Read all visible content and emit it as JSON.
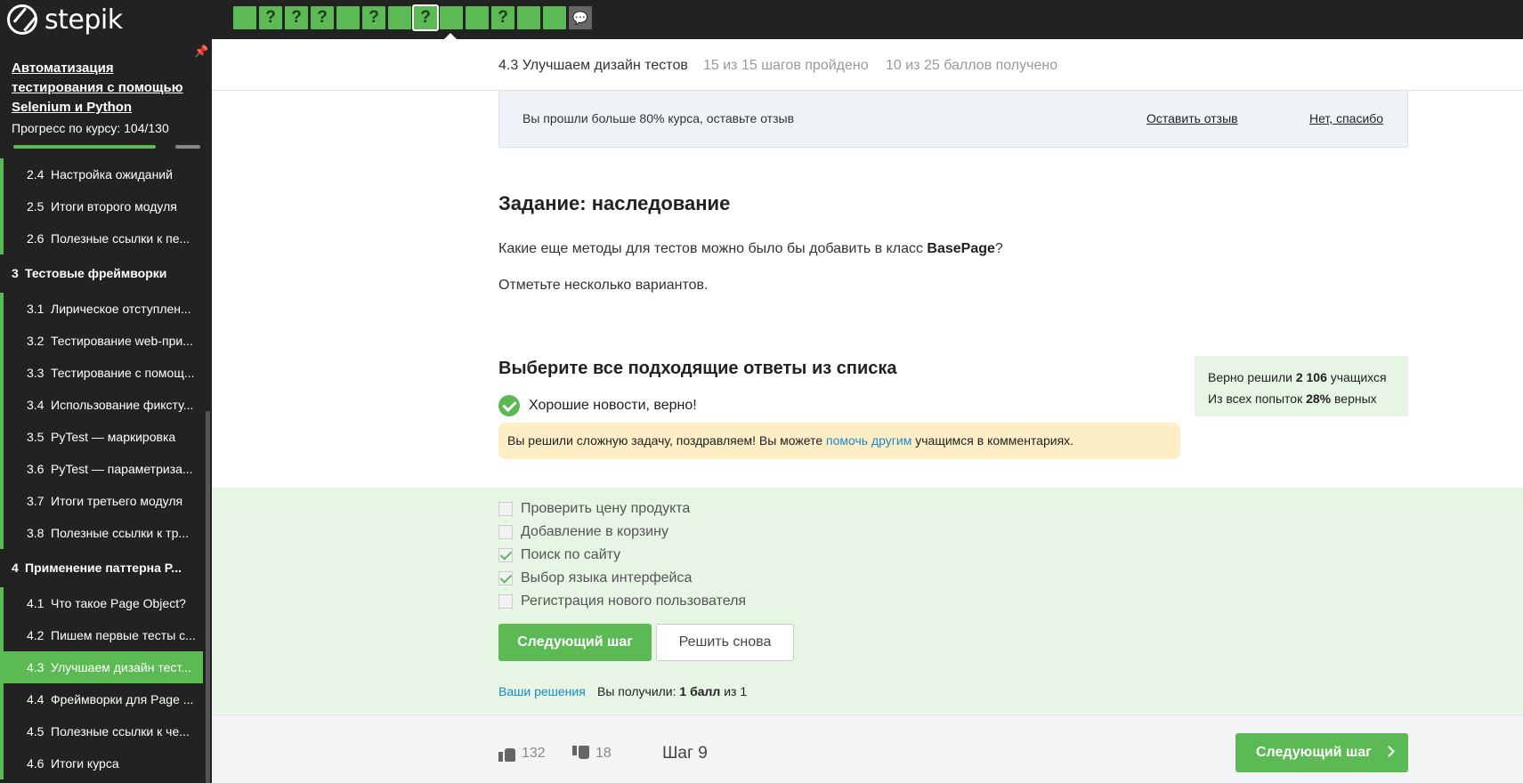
{
  "brand": {
    "name": "stepik"
  },
  "step_nav": {
    "items": [
      {
        "label": "",
        "state": "done"
      },
      {
        "label": "?",
        "state": "done"
      },
      {
        "label": "?",
        "state": "done"
      },
      {
        "label": "?",
        "state": "done"
      },
      {
        "label": "",
        "state": "done"
      },
      {
        "label": "?",
        "state": "done"
      },
      {
        "label": "",
        "state": "done"
      },
      {
        "label": "?",
        "state": "active"
      },
      {
        "label": "",
        "state": "done"
      },
      {
        "label": "",
        "state": "done"
      },
      {
        "label": "?",
        "state": "done"
      },
      {
        "label": "",
        "state": "done"
      },
      {
        "label": "",
        "state": "done"
      },
      {
        "label": "",
        "state": "comments"
      }
    ]
  },
  "sidebar": {
    "course_title": "Автоматизация тестирования с помощью Selenium и Python",
    "progress_label": "Прогресс по курсу:  104/130",
    "progress": {
      "done": 104,
      "total": 130
    },
    "items": [
      {
        "type": "lesson",
        "num": "2.4",
        "label": "Настройка ожиданий"
      },
      {
        "type": "lesson",
        "num": "2.5",
        "label": "Итоги второго модуля"
      },
      {
        "type": "lesson",
        "num": "2.6",
        "label": "Полезные ссылки к пе..."
      },
      {
        "type": "section",
        "num": "3",
        "label": "Тестовые фреймворки"
      },
      {
        "type": "lesson",
        "num": "3.1",
        "label": "Лирическое отступлен..."
      },
      {
        "type": "lesson",
        "num": "3.2",
        "label": "Тестирование web-при..."
      },
      {
        "type": "lesson",
        "num": "3.3",
        "label": "Тестирование с помощ..."
      },
      {
        "type": "lesson",
        "num": "3.4",
        "label": "Использование фиксту..."
      },
      {
        "type": "lesson",
        "num": "3.5",
        "label": "PyTest — маркировка"
      },
      {
        "type": "lesson",
        "num": "3.6",
        "label": "PyTest — параметриза..."
      },
      {
        "type": "lesson",
        "num": "3.7",
        "label": "Итоги третьего модуля"
      },
      {
        "type": "lesson",
        "num": "3.8",
        "label": "Полезные ссылки к тр..."
      },
      {
        "type": "section",
        "num": "4",
        "label": "Применение паттерна P..."
      },
      {
        "type": "lesson",
        "num": "4.1",
        "label": "Что такое Page Object?"
      },
      {
        "type": "lesson",
        "num": "4.2",
        "label": "Пишем первые тесты с..."
      },
      {
        "type": "lesson",
        "num": "4.3",
        "label": "Улучшаем дизайн тест...",
        "active": true
      },
      {
        "type": "lesson",
        "num": "4.4",
        "label": "Фреймворки для Page ..."
      },
      {
        "type": "lesson",
        "num": "4.5",
        "label": "Полезные ссылки к че..."
      },
      {
        "type": "lesson",
        "num": "4.6",
        "label": "Итоги курса"
      }
    ]
  },
  "lesson_header": {
    "title": "4.3 Улучшаем дизайн тестов",
    "steps": "15 из 15 шагов пройдено",
    "score": "10 из 25 баллов  получено"
  },
  "review_banner": {
    "text": "Вы прошли больше 80% курса, оставьте отзыв",
    "leave_review": "Оставить отзыв",
    "no_thanks": "Нет, спасибо"
  },
  "task": {
    "title": "Задание: наследование",
    "question_before": "Какие еще методы для тестов можно было бы добавить в класс ",
    "question_bold": "BasePage",
    "question_after": "?",
    "note": "Отметьте несколько вариантов."
  },
  "quiz": {
    "title": "Выберите все подходящие ответы из списка",
    "verdict": "Хорошие новости, верно!",
    "hint_before": "Вы решили сложную задачу, поздравляем! Вы можете ",
    "hint_link": "помочь другим",
    "hint_after": " учащимся в комментариях.",
    "stats": {
      "line1_before": "Верно решили ",
      "line1_bold": "2 106",
      "line1_after": " учащихся",
      "line2_before": "Из всех попыток ",
      "line2_bold": "28%",
      "line2_after": " верных"
    },
    "options": [
      {
        "label": "Проверить цену продукта",
        "checked": false
      },
      {
        "label": "Добавление в корзину",
        "checked": false
      },
      {
        "label": "Поиск по сайту",
        "checked": true
      },
      {
        "label": "Выбор языка интерфейса",
        "checked": true
      },
      {
        "label": "Регистрация нового пользователя",
        "checked": false
      }
    ],
    "next_button": "Следующий шаг",
    "retry_button": "Решить снова",
    "solutions_link": "Ваши решения",
    "got_before": "Вы получили: ",
    "got_bold": "1 балл",
    "got_after": " из 1"
  },
  "footer": {
    "likes": "132",
    "dislikes": "18",
    "step_label": "Шаг 9",
    "next_button": "Следующий шаг"
  },
  "colors": {
    "accent": "#5cba54",
    "topbar": "#222222",
    "answer_bg": "#e6f5e4",
    "hint_bg": "#fdeec5",
    "link": "#1e88c7"
  }
}
